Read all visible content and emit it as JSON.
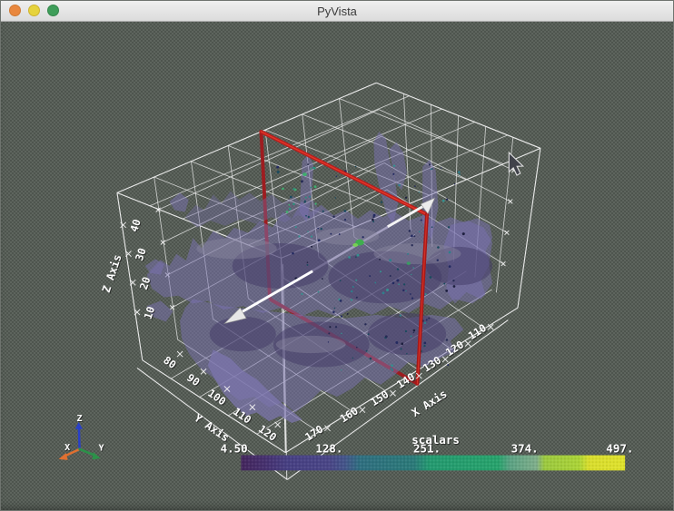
{
  "window": {
    "title": "PyVista",
    "traffic_lights": {
      "close": "close-window",
      "minimize": "minimize-window",
      "zoom": "zoom-window"
    }
  },
  "scene": {
    "axes": {
      "x": {
        "title": "X Axis",
        "ticks": [
          "170",
          "160",
          "150",
          "140",
          "130",
          "120",
          "110"
        ]
      },
      "y": {
        "title": "Y Axis",
        "ticks": [
          "80",
          "90",
          "100",
          "110",
          "120"
        ]
      },
      "z": {
        "title": "Z Axis",
        "ticks": [
          "10",
          "20",
          "30",
          "40"
        ]
      }
    },
    "orientation_widget": {
      "x": "X",
      "y": "Y",
      "z": "Z",
      "x_color": "#e07030",
      "y_color": "#2c9149",
      "z_color": "#2940c8"
    },
    "scalar_bar": {
      "title": "scalars",
      "labels": [
        "4.50",
        "128.",
        "251.",
        "374.",
        "497."
      ],
      "range": [
        4.5,
        497.0
      ],
      "stops": [
        {
          "pos": 0.0,
          "color": "#44265d"
        },
        {
          "pos": 0.06,
          "color": "#46306e"
        },
        {
          "pos": 0.12,
          "color": "#474083"
        },
        {
          "pos": 0.23,
          "color": "#4a4687"
        },
        {
          "pos": 0.27,
          "color": "#44558a"
        },
        {
          "pos": 0.31,
          "color": "#2f6f80"
        },
        {
          "pos": 0.45,
          "color": "#2b7a79"
        },
        {
          "pos": 0.49,
          "color": "#249a70"
        },
        {
          "pos": 0.67,
          "color": "#27a36c"
        },
        {
          "pos": 0.7,
          "color": "#5ba283"
        },
        {
          "pos": 0.77,
          "color": "#7fae8b"
        },
        {
          "pos": 0.79,
          "color": "#9cc93f"
        },
        {
          "pos": 0.88,
          "color": "#abd437"
        },
        {
          "pos": 0.905,
          "color": "#d9de2d"
        },
        {
          "pos": 1.0,
          "color": "#e0e22c"
        }
      ]
    },
    "colors": {
      "background": "#5e655e",
      "mesh": "#7a72b2",
      "plane_widget": "#b91c1c",
      "wireframe": "#f2f2f2"
    }
  }
}
